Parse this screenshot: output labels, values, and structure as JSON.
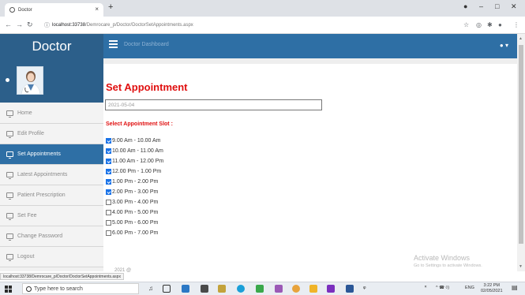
{
  "browser": {
    "tab_title": "Doctor",
    "tab_close": "×",
    "new_tab": "+",
    "url_host": "localhost:33738",
    "url_path": "/Demrocare_p/Doctor/DoctorSetAppointments.aspx",
    "status_url": "localhost:33738/Demrocare_p/Doctor/DoctorSetAppointments.aspx"
  },
  "header": {
    "brand": "Doctor",
    "dashboard_label": "Doctor Dashboard"
  },
  "sidebar": {
    "items": [
      {
        "label": "Home",
        "active": false
      },
      {
        "label": "Edit Profile",
        "active": false
      },
      {
        "label": "Set Appointments",
        "active": true
      },
      {
        "label": "Latest Appointments",
        "active": false
      },
      {
        "label": "Patient Prescription",
        "active": false
      },
      {
        "label": "Set Fee",
        "active": false
      },
      {
        "label": "Change Password",
        "active": false
      },
      {
        "label": "Logout",
        "active": false
      }
    ]
  },
  "main": {
    "title": "Set Appointment",
    "date_value": "2021-05-04",
    "slot_heading": "Select Appointment Slot :",
    "slots": [
      {
        "label": "9.00 Am - 10.00 Am",
        "checked": true
      },
      {
        "label": "10.00 Am - 11.00 Am",
        "checked": true
      },
      {
        "label": "11.00 Am - 12.00 Pm",
        "checked": true
      },
      {
        "label": "12.00 Pm - 1.00 Pm",
        "checked": true
      },
      {
        "label": "1.00 Pm - 2.00 Pm",
        "checked": true
      },
      {
        "label": "2.00 Pm - 3.00 Pm",
        "checked": true
      },
      {
        "label": "3.00 Pm - 4.00 Pm",
        "checked": false
      },
      {
        "label": "4.00 Pm - 5.00 Pm",
        "checked": false
      },
      {
        "label": "5.00 Pm - 6.00 Pm",
        "checked": false
      },
      {
        "label": "6.00 Pm - 7.00 Pm",
        "checked": false
      }
    ],
    "year_fragment": "2021 @"
  },
  "watermark": {
    "line1": "Activate Windows",
    "line2": "Go to Settings to activate Windows."
  },
  "taskbar": {
    "search_placeholder": "Type here to search",
    "lang": "ENG",
    "time": "3:22 PM",
    "date": "02/05/2021"
  },
  "colors": {
    "brand_bg": "#2c5f8a",
    "nav_bg": "#2e6fa5",
    "title_red": "#e00f0f"
  },
  "icons": [
    "tab-favicon-icon",
    "back-icon",
    "forward-icon",
    "reload-icon",
    "info-icon",
    "star-icon",
    "extension-icon",
    "account-icon",
    "menu-icon",
    "hamburger-icon",
    "user-icon",
    "monitor-icon",
    "windows-icon",
    "search-icon"
  ]
}
